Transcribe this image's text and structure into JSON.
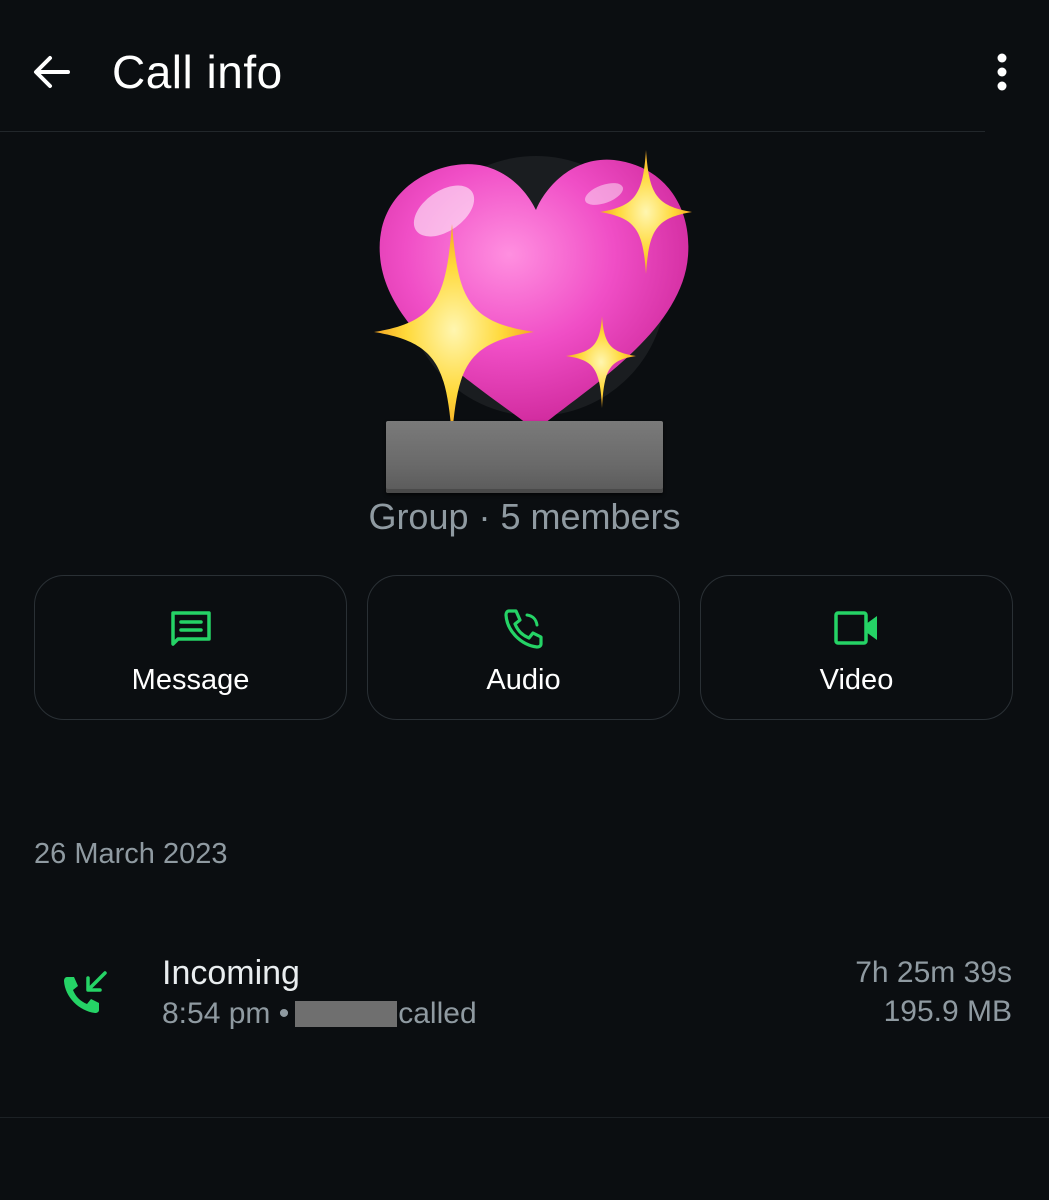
{
  "header": {
    "title": "Call info",
    "back_icon": "arrow-left-icon",
    "more_icon": "more-vertical-icon"
  },
  "profile": {
    "avatar_icon": "sparkling-heart-icon",
    "subtitle": "Group · 5 members"
  },
  "actions": [
    {
      "label": "Message",
      "icon": "message-icon"
    },
    {
      "label": "Audio",
      "icon": "phone-icon"
    },
    {
      "label": "Video",
      "icon": "video-icon"
    }
  ],
  "call_log": {
    "date": "26 March 2023",
    "entries": [
      {
        "direction": "Incoming",
        "time": "8:54 pm •",
        "called_text": "called",
        "duration": "7h 25m 39s",
        "data_used": "195.9 MB",
        "icon": "incoming-call-icon"
      }
    ]
  },
  "colors": {
    "background": "#0b0e11",
    "accent_green": "#25d366",
    "text_primary": "#e9edef",
    "text_secondary": "#8f9aa1",
    "button_border": "#2a3035"
  }
}
